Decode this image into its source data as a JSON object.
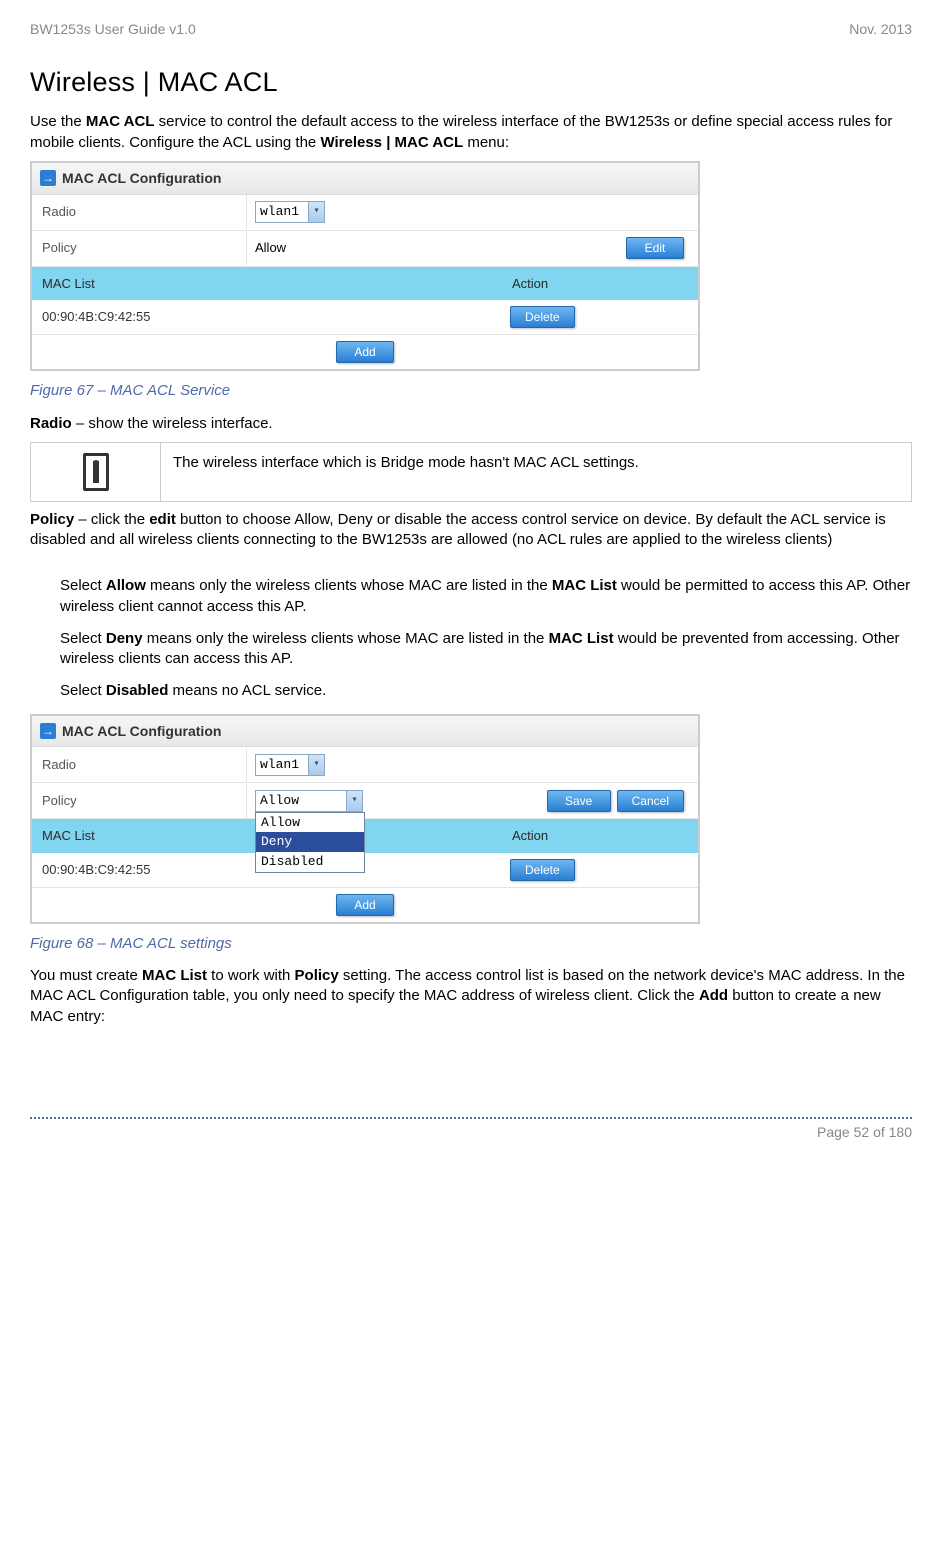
{
  "header": {
    "left": "BW1253s User Guide v1.0",
    "right": "Nov.  2013"
  },
  "title": "Wireless | MAC ACL",
  "intro_p1_a": "Use the ",
  "intro_p1_b": "MAC ACL",
  "intro_p1_c": " service to control the default access to the wireless interface of the BW1253s or define special access rules for mobile clients. Configure the ACL using the ",
  "intro_p1_d": "Wireless | MAC ACL",
  "intro_p1_e": " menu:",
  "panel1": {
    "title": "MAC ACL Configuration",
    "radio_label": "Radio",
    "radio_value": "wlan1",
    "policy_label": "Policy",
    "policy_value": "Allow",
    "btn_edit": "Edit",
    "list_col1": "MAC List",
    "list_col2": "Action",
    "mac_value": "00:90:4B:C9:42:55",
    "btn_delete": "Delete",
    "btn_add": "Add"
  },
  "fig1": "Figure 67 – MAC ACL Service",
  "radio_line_a": "Radio",
  "radio_line_b": " – show the wireless interface.",
  "info_text": "The wireless interface which is Bridge mode hasn't MAC ACL settings.",
  "policy_para_a": "Policy",
  "policy_para_b": " – click the ",
  "policy_para_c": "edit",
  "policy_para_d": " button to choose Allow, Deny or disable the access control service on device. By default the ACL service is disabled and all wireless clients connecting to the BW1253s are allowed (no ACL rules are applied to the wireless clients)",
  "allow_a": "Select ",
  "allow_b": "Allow",
  "allow_c": " means only the wireless clients whose MAC are listed in the ",
  "allow_d": "MAC List",
  "allow_e": " would be permitted to access this AP. Other wireless client cannot access this AP.",
  "deny_a": "Select ",
  "deny_b": "Deny",
  "deny_c": " means only the wireless clients whose MAC are listed in the ",
  "deny_d": "MAC List",
  "deny_e": " would be prevented from accessing. Other wireless clients can access this AP.",
  "disabled_a": "Select ",
  "disabled_b": "Disabled",
  "disabled_c": " means no ACL service.",
  "panel2": {
    "title": "MAC ACL Configuration",
    "radio_label": "Radio",
    "radio_value": "wlan1",
    "policy_label": "Policy",
    "policy_selected": "Allow",
    "options": {
      "allow": "Allow",
      "deny": "Deny",
      "disabled": "Disabled"
    },
    "btn_save": "Save",
    "btn_cancel": "Cancel",
    "list_col1": "MAC List",
    "list_col2": "Action",
    "mac_value": "00:90:4B:C9:42:55",
    "btn_delete": "Delete",
    "btn_add": "Add"
  },
  "fig2": "Figure 68 – MAC ACL settings",
  "final_a": "You must create ",
  "final_b": "MAC List",
  "final_c": " to work with ",
  "final_d": "Policy",
  "final_e": " setting. The access control list is based on the network device's MAC address. In the MAC ACL Configuration table, you only need to specify the MAC address of wireless client. Click the ",
  "final_f": "Add",
  "final_g": " button to create a new MAC entry:",
  "footer_page": "Page 52 of 180"
}
